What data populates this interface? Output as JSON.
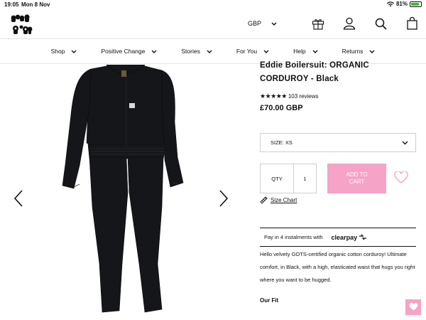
{
  "status": {
    "time": "19:05",
    "date": "Mon 8 Nov",
    "battery": "81%",
    "battery_level": 0.81
  },
  "brand": {
    "logo_text": "Lucy & Yak"
  },
  "header": {
    "currency": "GBP"
  },
  "nav": {
    "items": [
      "Shop",
      "Positive Change",
      "Stories",
      "For You",
      "Help",
      "Returns"
    ]
  },
  "product": {
    "title": "Eddie Boilersuit: ORGANIC CORDUROY - Black",
    "rating": 5,
    "reviews": "103 reviews",
    "price": "£70.00 GBP",
    "size_label": "SIZE: XS",
    "qty_label": "QTY",
    "qty_value": "1",
    "add_to_cart": "ADD TO CART",
    "size_chart": "Size Chart",
    "clearpay_text": "Pay in 4 instalments with",
    "clearpay_brand": "clearpay",
    "description": "Hello velvety GOTS-certified organic cotton corduroy! Ultimate comfort, in Black, with a high, elasticated waist that hugs you right where you want to be hugged.",
    "fit_heading": "Our Fit"
  },
  "colors": {
    "accent_pink": "#f5a3c6",
    "text": "#111111"
  }
}
